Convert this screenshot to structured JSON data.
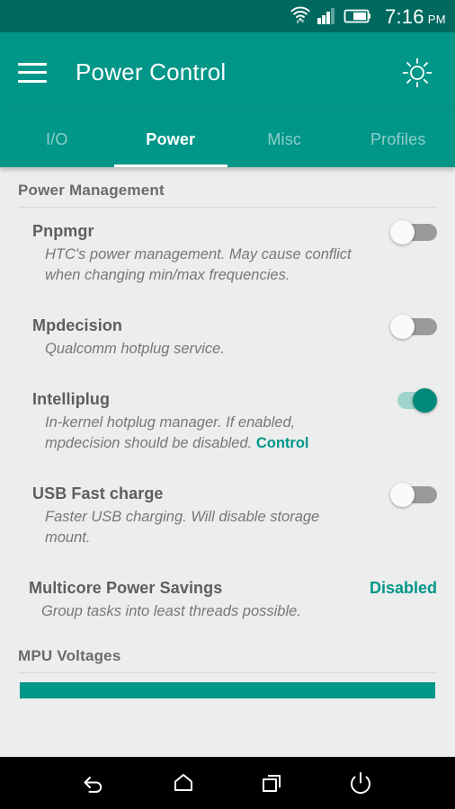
{
  "statusbar": {
    "time": "7:16",
    "ampm": "PM",
    "icons": [
      "wifi-icon",
      "signal-icon",
      "battery-icon"
    ]
  },
  "appbar": {
    "menu_label": "menu-icon",
    "title": "Power Control",
    "action_icon": "brightness-icon"
  },
  "tabs": [
    {
      "label": "I/O",
      "active": false
    },
    {
      "label": "Power",
      "active": true
    },
    {
      "label": "Misc",
      "active": false
    },
    {
      "label": "Profiles",
      "active": false
    }
  ],
  "sections": [
    {
      "header": "Power Management",
      "items": [
        {
          "title": "Pnpmgr",
          "summary": "HTC's power management. May cause conflict when changing min/max frequencies.",
          "toggle": "off"
        },
        {
          "title": "Mpdecision",
          "summary": "Qualcomm hotplug service.",
          "toggle": "off"
        },
        {
          "title": "Intelliplug",
          "summary": "In-kernel hotplug manager. If enabled, mpdecision should be disabled.",
          "link": "Control",
          "toggle": "on"
        },
        {
          "title": "USB Fast charge",
          "summary": "Faster USB charging. Will disable storage mount.",
          "toggle": "off"
        },
        {
          "title": "Multicore Power Savings",
          "summary": "Group tasks into least threads possible.",
          "value": "Disabled"
        }
      ]
    },
    {
      "header": "MPU Voltages",
      "items": []
    }
  ],
  "navbar": {
    "back": "back-icon",
    "home": "home-icon",
    "recents": "recents-icon",
    "power": "power-icon"
  },
  "colors": {
    "primary": "#009688",
    "primary_dark": "#00695f",
    "accent": "#009688",
    "background": "#eceded",
    "toggle_on_thumb": "#00897b",
    "toggle_on_track": "#9fd4cd",
    "toggle_off_track": "#9a9a9a"
  }
}
